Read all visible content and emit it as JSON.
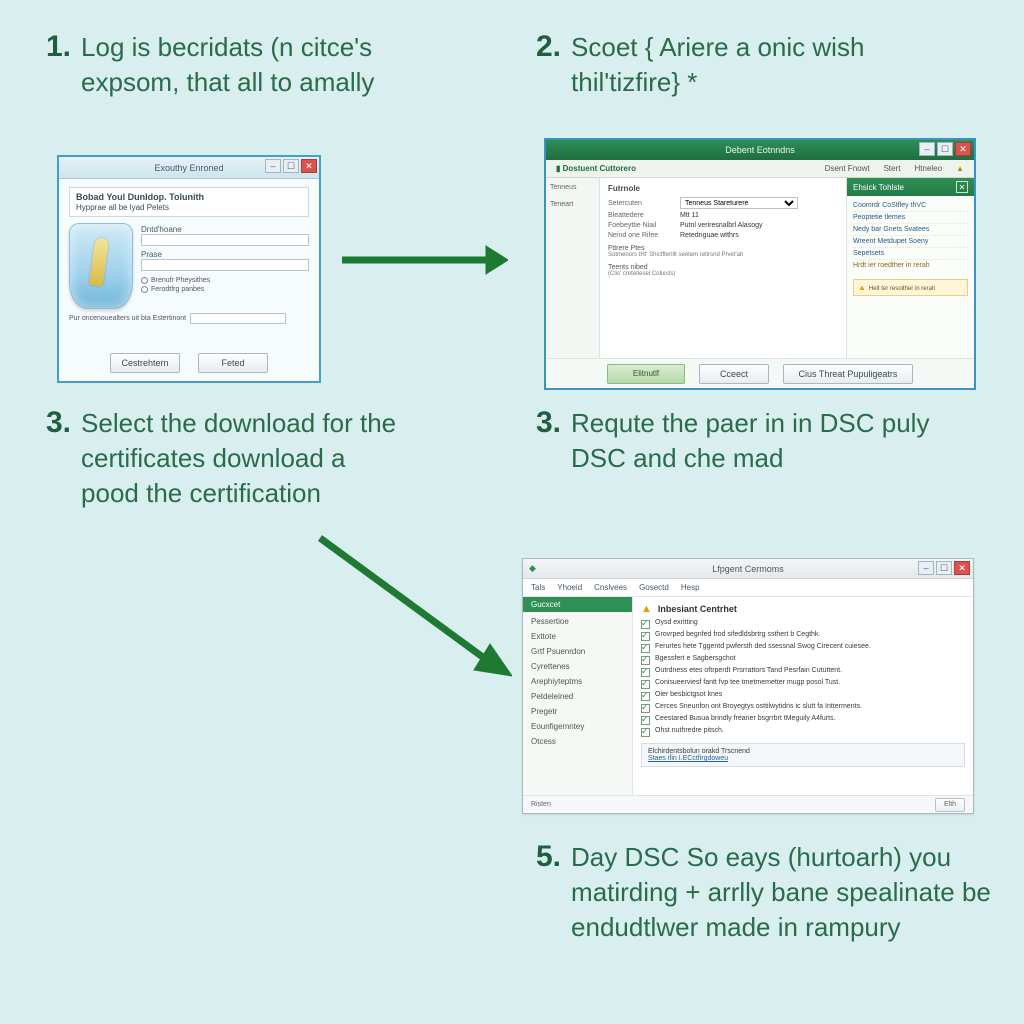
{
  "steps": {
    "s1": {
      "num": "1.",
      "text": "Log is becridats (n citce's expsom, that all to amally"
    },
    "s2": {
      "num": "2.",
      "text": "Scoet { Ariere a onic wish thil'tizfire} *"
    },
    "s3": {
      "num": "3.",
      "text": "Select the download for the certificates download a pood the certification"
    },
    "s4": {
      "num": "3.",
      "text": "Requte the paer in in DSC puly DSC and che mad"
    },
    "s5": {
      "num": "5.",
      "text": "Day DSC So eays (hurtoarh) you matirding + arrlly bane spealinate be endudtlwer made in rampury"
    }
  },
  "win1": {
    "title": "Exouthy Enroned",
    "banner_b": "Bobad Youl Dunldop. Tolunith",
    "banner_s": "Hypprae all be lyad Pelets",
    "field1": "Dntd'hoane",
    "field2": "Prase",
    "radio1": "Brenufr Pheysithes",
    "radio2": "Ferodtfrg panbes",
    "footnote": "Pur oncenouealters uit bta Estertinont",
    "btn1": "Cestrehtern",
    "btn2": "Feted"
  },
  "win2": {
    "title": "Debent Eotnndns",
    "brand": "Dostuent Cuttorero",
    "tabs": [
      "Dsent Fnowt",
      "Stert",
      "Htneleo"
    ],
    "left": [
      "Tenneus",
      "Teneart"
    ],
    "section": "Futrnole",
    "select_label": "Tenneus Stareturere",
    "rows": [
      [
        "Setercuten",
        "Mtt 11"
      ],
      [
        "Bleattedere",
        "Putnl veriresnalbrl Alasogy"
      ],
      [
        "Foebeyttie Niail",
        "Retednguae wtthrs"
      ],
      [
        "Neind one Rifee",
        ""
      ]
    ],
    "subh1": "Fttrere Ptes",
    "note1": "Sotmenors tHt' Shictfterillt seetem retirsnd Prvet'ah",
    "subh2": "Teents nibed",
    "note2": "(Clis' cretetiesel Cotiests)",
    "panel_title": "Ehsick Tohlste",
    "panel_items": [
      "Coomrdr CoStfley thVC",
      "Peoptetie tlemes",
      "Nedy bar Gnets Svatees",
      "Wreent Metdupet Soeny",
      "Sepetsets",
      "Hrdt ier roedther in rerah"
    ],
    "btn1": "Elitnutlf",
    "btn2": "Cceect",
    "btn3": "Cius Threat Pupuligeatrs"
  },
  "win3": {
    "title": "Lfpgent Cermoms",
    "menu": [
      "Tals",
      "Yhoeid",
      "Cnslvees",
      "Gosectd",
      "Hesp"
    ],
    "side_sel": "Gucxcet",
    "side": [
      "Pessertioe",
      "Exttote",
      "Grtf Psuenrdon",
      "Cyrettenes",
      "Arephiyteptms",
      "Petdeleined",
      "Pregetr",
      "Eounfigemntey",
      "Otcess"
    ],
    "header": "Inbesiant Centrhet",
    "checks": [
      "Oysd exritting",
      "Grovrped begnfed frod sifedldsbrtrg ssthert b Cegthk.",
      "Ferurtes hete Tggentd pwfersth ded ssessnal Swog Cirecent cuiesee.",
      "Bgessfert e Sagbersgchot",
      "Outrdness etes oftrperdt Prsrrattors Tand Pesrfain Cututtent.",
      "Conisueerviesf fantt fvp tee tmetmemetter mugp posol Tust.",
      "Oier besbictgsot knes",
      "Cerces Sneunfon ont Broyegtys osttilwytidns ic slutt fa Intterments.",
      "Ceestared Busua brindly freaner bsgrrbrt tMeguily A4furts.",
      "Ohst nuthredre pitsch."
    ],
    "linkbox_t": "Elchirdentsbolun orakd Trscnend",
    "linkbox_l": "Staes ifin I.ECctfirgdoweu",
    "status_btn": "Elth"
  }
}
